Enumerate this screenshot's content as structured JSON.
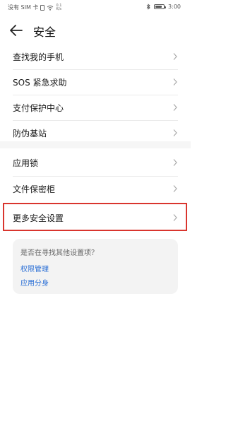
{
  "status_bar": {
    "carrier": "没有 SIM 卡",
    "speed_top": "0.1",
    "speed_bottom": "K/s",
    "time": "3:00",
    "battery_fraction": 0.8
  },
  "header": {
    "title": "安全"
  },
  "menu": {
    "items": [
      {
        "label": "查找我的手机"
      },
      {
        "label": "SOS 紧急求助"
      },
      {
        "label": "支付保护中心"
      },
      {
        "label": "防伪基站"
      },
      {
        "label": "应用锁"
      },
      {
        "label": "文件保密柜"
      },
      {
        "label": "更多安全设置"
      }
    ]
  },
  "suggestion_card": {
    "question": "是否在寻找其他设置项？",
    "links": [
      {
        "label": "权限管理"
      },
      {
        "label": "应用分身"
      }
    ]
  },
  "colors": {
    "highlight": "#d9352e",
    "link": "#2a6fd6"
  }
}
